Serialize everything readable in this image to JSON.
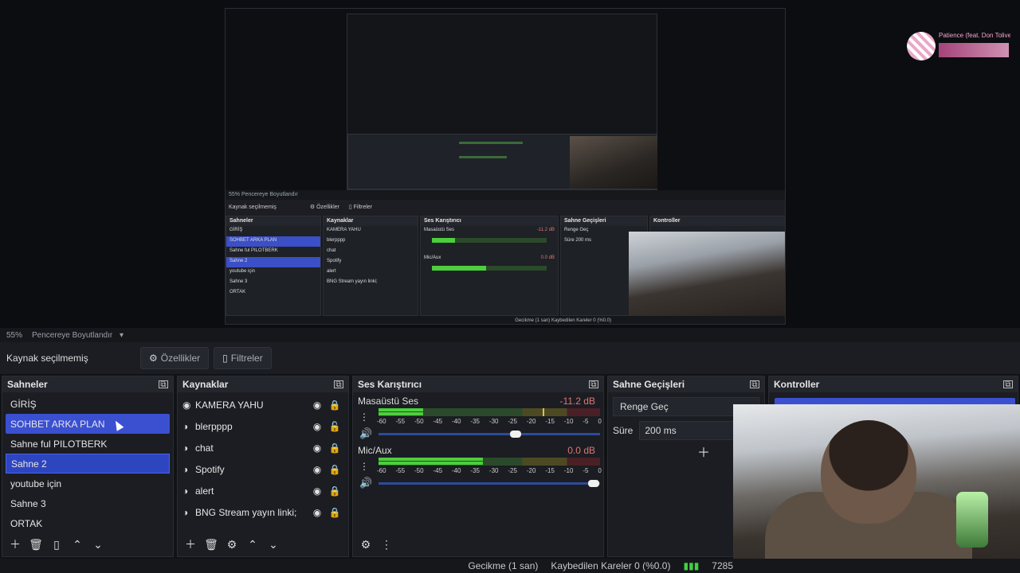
{
  "preview": {
    "nested": {
      "zoom": "55%",
      "zoom_mode": "Pencereye Boyutlandır",
      "no_source": "Kaynak seçilmemiş",
      "properties": "Özellikler",
      "filters": "Filtreler",
      "scenes_title": "Sahneler",
      "sources_title": "Kaynaklar",
      "mixer_title": "Ses Karıştırıcı",
      "transitions_title": "Sahne Geçişleri",
      "controls_title": "Kontroller",
      "transition_value": "Renge Geç",
      "duration_label": "Süre",
      "duration_value": "200 ms",
      "desktop_db": "-11.2 dB",
      "mic_db": "0.0 dB",
      "status": "Gecikme (1 san)   Kaybedilen Kareler 0 (%0.0)"
    },
    "overlay_song": "Patience (feat. Don Toliver)"
  },
  "preview_bar": {
    "zoom": "55%",
    "zoom_mode": "Pencereye Boyutlandır"
  },
  "source_bar": {
    "label": "Kaynak seçilmemiş",
    "properties": "Özellikler",
    "filters": "Filtreler"
  },
  "scenes": {
    "title": "Sahneler",
    "items": [
      {
        "label": "GİRİŞ"
      },
      {
        "label": "SOHBET ARKA PLAN"
      },
      {
        "label": "Sahne ful PILOTBERK"
      },
      {
        "label": "Sahne 2"
      },
      {
        "label": "youtube için"
      },
      {
        "label": "Sahne 3"
      },
      {
        "label": "ORTAK"
      }
    ]
  },
  "sources": {
    "title": "Kaynaklar",
    "items": [
      {
        "label": "KAMERA YAHU",
        "icon": "camera-icon"
      },
      {
        "label": "blerpppp",
        "icon": "globe-icon"
      },
      {
        "label": "chat",
        "icon": "globe-icon"
      },
      {
        "label": "Spotify",
        "icon": "globe-icon"
      },
      {
        "label": "alert",
        "icon": "globe-icon"
      },
      {
        "label": "BNG Stream yayın linki;",
        "icon": "globe-icon"
      }
    ]
  },
  "mixer": {
    "title": "Ses Karıştırıcı",
    "tracks": [
      {
        "name": "Masaüstü Ses",
        "db": "-11.2 dB",
        "level": 0.2,
        "volume": 0.62
      },
      {
        "name": "Mic/Aux",
        "db": "0.0 dB",
        "level": 0.47,
        "volume": 0.97
      }
    ],
    "scale": [
      "-60",
      "-55",
      "-50",
      "-45",
      "-40",
      "-35",
      "-30",
      "-25",
      "-20",
      "-15",
      "-10",
      "-5",
      "0"
    ]
  },
  "transitions": {
    "title": "Sahne Geçişleri",
    "selected": "Renge Geç",
    "duration_label": "Süre",
    "duration_value": "200 ms"
  },
  "controls": {
    "title": "Kontroller"
  },
  "status": {
    "delay": "Gecikme (1 san)",
    "dropped": "Kaybedilen Kareler 0 (%0.0)",
    "fps": "7285"
  },
  "colors": {
    "accent": "#3b50d1",
    "meter_green": "#4ccf3d"
  }
}
